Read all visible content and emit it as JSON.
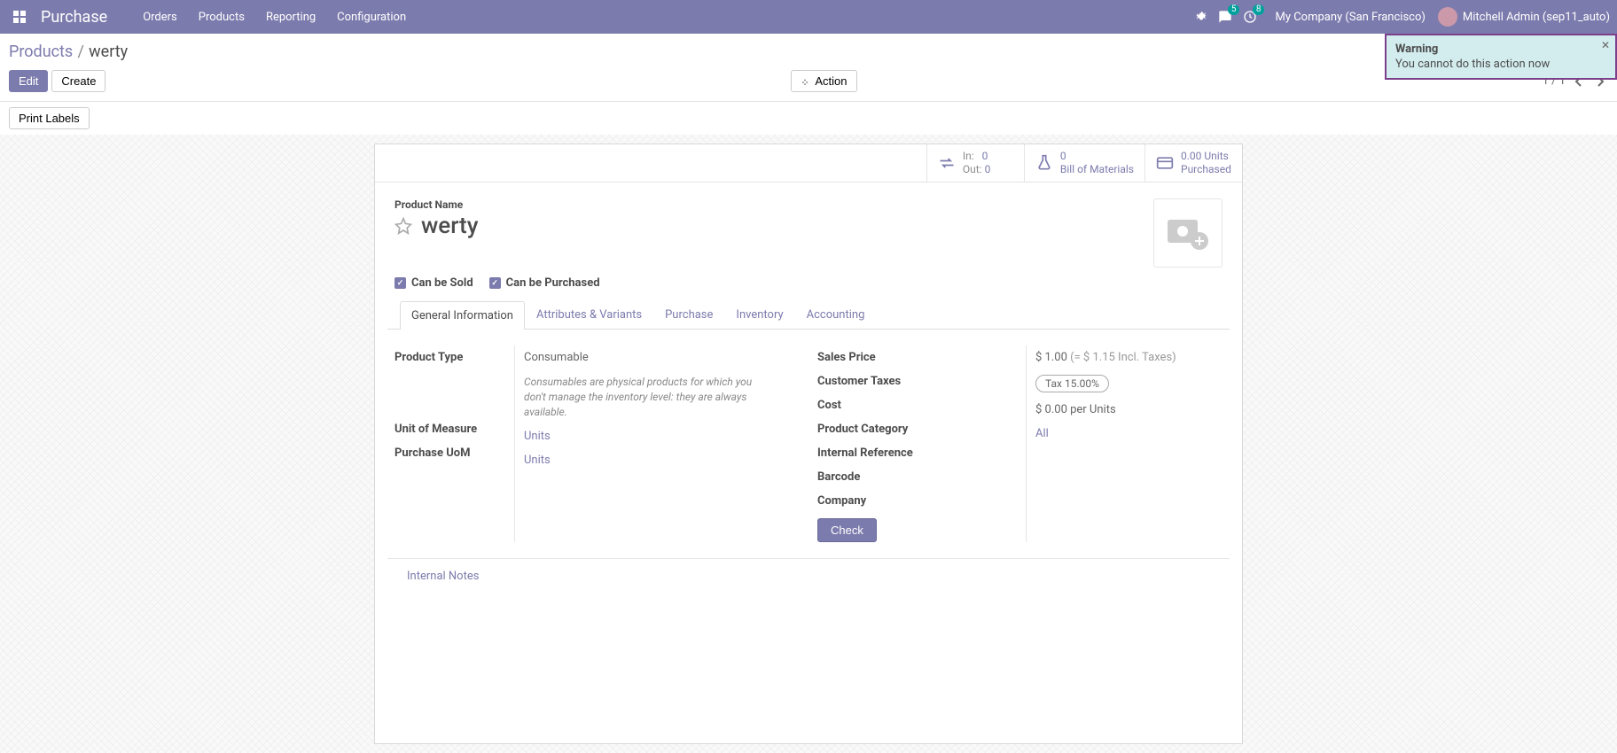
{
  "nav": {
    "app_title": "Purchase",
    "menu": [
      "Orders",
      "Products",
      "Reporting",
      "Configuration"
    ],
    "messages_badge": "5",
    "activities_badge": "8",
    "company": "My Company (San Francisco)",
    "user": "Mitchell Admin (sep11_auto)"
  },
  "breadcrumb": {
    "root": "Products",
    "current": "werty"
  },
  "buttons": {
    "edit": "Edit",
    "create": "Create",
    "action": "Action",
    "print_labels": "Print Labels"
  },
  "pager": {
    "value": "1 / 1"
  },
  "toast": {
    "title": "Warning",
    "message": "You cannot do this action now"
  },
  "stats": {
    "in_label": "In:",
    "in_val": "0",
    "out_label": "Out:",
    "out_val": "0",
    "bom_val": "0",
    "bom_label": "Bill of Materials",
    "purch_val": "0.00 Units",
    "purch_label": "Purchased"
  },
  "product": {
    "name_label": "Product Name",
    "name": "werty",
    "can_be_sold": "Can be Sold",
    "can_be_purchased": "Can be Purchased"
  },
  "tabs": [
    "General Information",
    "Attributes & Variants",
    "Purchase",
    "Inventory",
    "Accounting"
  ],
  "fields_left": {
    "product_type_label": "Product Type",
    "product_type_value": "Consumable",
    "product_type_hint": "Consumables are physical products for which you don't manage the inventory level: they are always available.",
    "uom_label": "Unit of Measure",
    "uom_value": "Units",
    "puom_label": "Purchase UoM",
    "puom_value": "Units"
  },
  "fields_right": {
    "sales_price_label": "Sales Price",
    "sales_price_value": "$ 1.00",
    "sales_price_extra": "(= $ 1.15 Incl. Taxes)",
    "customer_taxes_label": "Customer Taxes",
    "customer_taxes_value": "Tax 15.00%",
    "cost_label": "Cost",
    "cost_value": "$ 0.00 per Units",
    "category_label": "Product Category",
    "category_value": "All",
    "internal_ref_label": "Internal Reference",
    "barcode_label": "Barcode",
    "company_label": "Company",
    "check_btn": "Check"
  },
  "notes_label": "Internal Notes"
}
